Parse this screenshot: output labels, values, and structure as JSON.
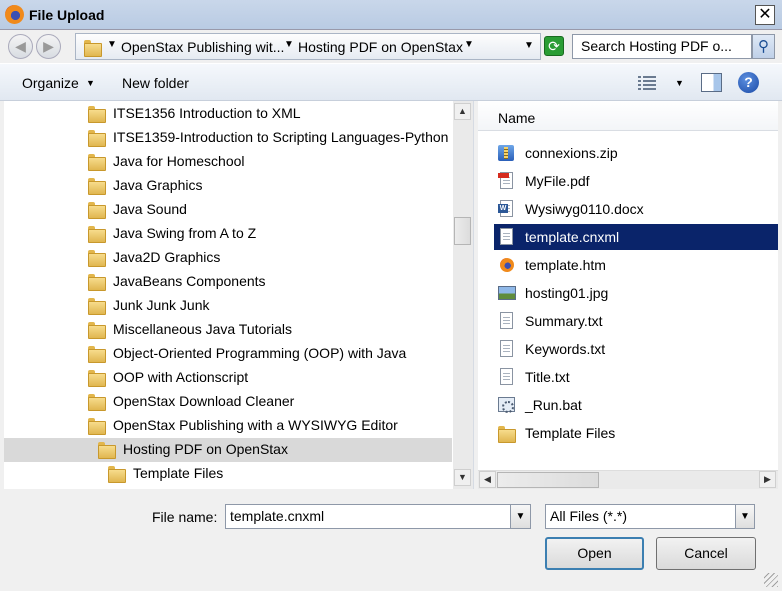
{
  "window": {
    "title": "File Upload",
    "close": "✕"
  },
  "nav": {
    "back": "◀",
    "forward": "▶",
    "breadcrumb": [
      "OpenStax Publishing wit...",
      "Hosting PDF on OpenStax"
    ],
    "search_placeholder": "Search Hosting PDF o..."
  },
  "toolbar": {
    "organize": "Organize",
    "new_folder": "New folder",
    "help": "?"
  },
  "tree": {
    "items": [
      "ITSE1356 Introduction to XML",
      "ITSE1359-Introduction to Scripting Languages-Python",
      "Java for Homeschool",
      "Java Graphics",
      "Java Sound",
      "Java Swing from A to Z",
      "Java2D Graphics",
      "JavaBeans Components",
      "Junk Junk Junk",
      "Miscellaneous Java Tutorials",
      "Object-Oriented Programming (OOP) with Java",
      "OOP with Actionscript",
      "OpenStax Download Cleaner",
      "OpenStax Publishing with a WYSIWYG Editor",
      "Hosting PDF on OpenStax",
      "Template Files"
    ],
    "selected_index": 14
  },
  "files": {
    "column_name": "Name",
    "items": [
      {
        "name": "connexions.zip",
        "icon": "zip-icon"
      },
      {
        "name": "MyFile.pdf",
        "icon": "pdf-icon"
      },
      {
        "name": "Wysiwyg0110.docx",
        "icon": "word-icon"
      },
      {
        "name": "template.cnxml",
        "icon": "document-icon"
      },
      {
        "name": "template.htm",
        "icon": "firefox-html-icon"
      },
      {
        "name": "hosting01.jpg",
        "icon": "image-icon"
      },
      {
        "name": "Summary.txt",
        "icon": "text-file-icon"
      },
      {
        "name": "Keywords.txt",
        "icon": "text-file-icon"
      },
      {
        "name": "Title.txt",
        "icon": "text-file-icon"
      },
      {
        "name": "_Run.bat",
        "icon": "batch-file-icon"
      },
      {
        "name": "Template Files",
        "icon": "folder-icon"
      }
    ],
    "selected_index": 3
  },
  "form": {
    "file_name_label": "File name:",
    "file_name_value": "template.cnxml",
    "filter_value": "All Files (*.*)",
    "open": "Open",
    "cancel": "Cancel"
  }
}
